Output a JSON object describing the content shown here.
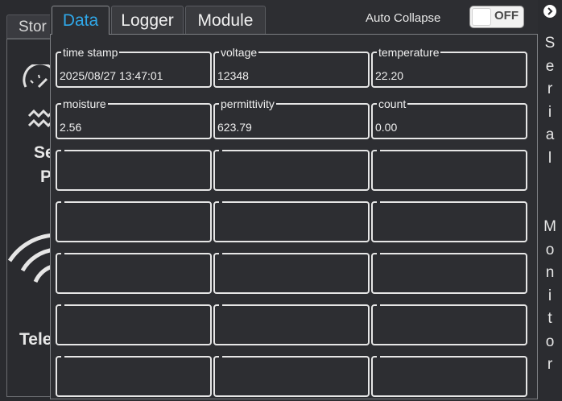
{
  "background": {
    "tab_label": "Stor",
    "label_1": "Se",
    "label_2": "P",
    "label_3": "Tele"
  },
  "tabs": [
    {
      "label": "Data",
      "active": true
    },
    {
      "label": "Logger",
      "active": false
    },
    {
      "label": "Module",
      "active": false
    }
  ],
  "auto_collapse": {
    "label": "Auto Collapse",
    "state": "OFF"
  },
  "data_cells": [
    {
      "label": "time stamp",
      "value": "2025/08/27 13:47:01"
    },
    {
      "label": "voltage",
      "value": "12348"
    },
    {
      "label": "temperature",
      "value": "22.20"
    },
    {
      "label": "moisture",
      "value": "2.56"
    },
    {
      "label": "permittivity",
      "value": "623.79"
    },
    {
      "label": "count",
      "value": "0.00"
    }
  ],
  "empty_cell_count": 15,
  "serial_monitor": {
    "letters": [
      "S",
      "e",
      "r",
      "i",
      "a",
      "l",
      "",
      "",
      "M",
      "o",
      "n",
      "i",
      "t",
      "o",
      "r"
    ]
  },
  "colors": {
    "accent": "#2fa7e8",
    "background": "#2d2e32",
    "border": "#e6e6e6"
  }
}
